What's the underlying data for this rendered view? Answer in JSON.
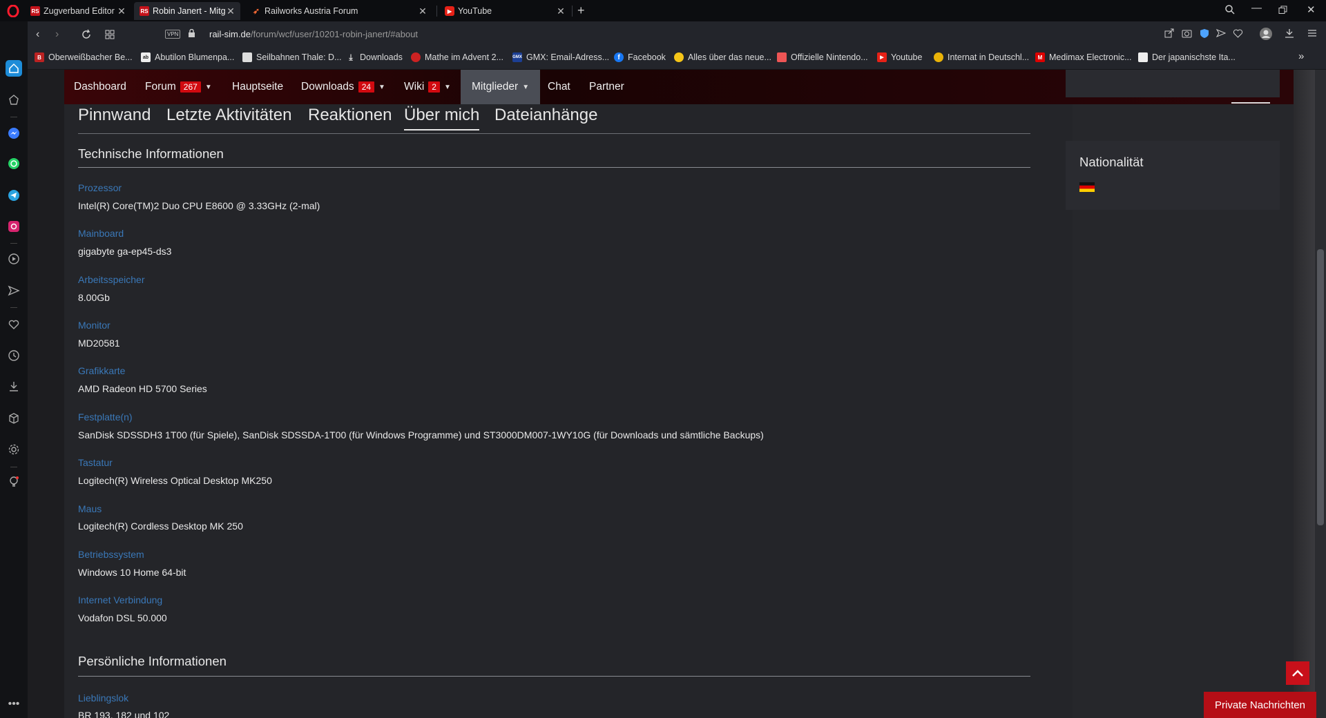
{
  "browser": {
    "tabs": [
      {
        "title": "Zugverband Editor stürzt ab",
        "favicon": "RS",
        "active": false
      },
      {
        "title": "Robin Janert - Mitglieder - ",
        "favicon": "RS",
        "active": true
      },
      {
        "title": "Railworks Austria Forum",
        "favicon": "RA",
        "active": false
      },
      {
        "title": "YouTube",
        "favicon": "YT",
        "active": false
      }
    ],
    "url_host": "rail-sim.de",
    "url_path": "/forum/wcf/user/10201-robin-janert/#about",
    "vpn_label": "VPN",
    "bookmarks": [
      "Oberweißbacher Be...",
      "Abutilon Blumenpa...",
      "Seilbahnen Thale: D...",
      "Downloads",
      "Mathe im Advent 2...",
      "GMX: Email-Adress...",
      "Facebook",
      "Alles über das neue...",
      "Offizielle Nintendo...",
      "Youtube",
      "Internat in Deutschl...",
      "Medimax Electronic...",
      "Der japanischste Ita..."
    ],
    "bookmark_icons": [
      "B",
      "ab",
      "",
      "",
      "",
      "GMX",
      "f",
      "",
      "",
      "",
      "",
      "M",
      ""
    ],
    "bookmarks_more": "»"
  },
  "site_nav": {
    "items": [
      {
        "label": "Dashboard"
      },
      {
        "label": "Forum",
        "badge": "267",
        "dropdown": true
      },
      {
        "label": "Hauptseite"
      },
      {
        "label": "Downloads",
        "badge": "24",
        "dropdown": true
      },
      {
        "label": "Wiki",
        "badge": "2",
        "dropdown": true
      },
      {
        "label": "Mitglieder",
        "dropdown": true,
        "active": true
      },
      {
        "label": "Chat"
      },
      {
        "label": "Partner"
      }
    ]
  },
  "profile_tabs": [
    "Pinnwand",
    "Letzte Aktivitäten",
    "Reaktionen",
    "Über mich",
    "Dateianhänge"
  ],
  "active_profile_tab": "Über mich",
  "tech_section": {
    "title": "Technische Informationen",
    "fields": [
      {
        "label": "Prozessor",
        "value": "Intel(R) Core(TM)2 Duo CPU E8600 @ 3.33GHz (2-mal)"
      },
      {
        "label": "Mainboard",
        "value": "gigabyte ga-ep45-ds3"
      },
      {
        "label": "Arbeitsspeicher",
        "value": "8.00Gb"
      },
      {
        "label": "Monitor",
        "value": "MD20581"
      },
      {
        "label": "Grafikkarte",
        "value": "AMD Radeon HD 5700 Series"
      },
      {
        "label": "Festplatte(n)",
        "value": "SanDisk SDSSDH3 1T00 (für Spiele), SanDisk SDSSDA-1T00 (für Windows Programme) und ST3000DM007-1WY10G (für Downloads und sämtliche Backups)"
      },
      {
        "label": "Tastatur",
        "value": "Logitech(R) Wireless Optical Desktop MK250"
      },
      {
        "label": "Maus",
        "value": "Logitech(R) Cordless Desktop MK 250"
      },
      {
        "label": "Betriebssystem",
        "value": "Windows 10 Home 64-bit"
      },
      {
        "label": "Internet Verbindung",
        "value": "Vodafon DSL 50.000"
      }
    ]
  },
  "personal_section": {
    "title": "Persönliche Informationen",
    "fields": [
      {
        "label": "Lieblingslok",
        "value": "BR 193, 182 und 102"
      }
    ]
  },
  "sidebar": {
    "nationality_title": "Nationalität",
    "nationality_flag": "germany-flag-icon"
  },
  "private_messages_label": "Private Nachrichten",
  "colors": {
    "accent_red": "#c8101a",
    "label_blue": "#3a78b8",
    "nav_bg": "#1a0304"
  }
}
